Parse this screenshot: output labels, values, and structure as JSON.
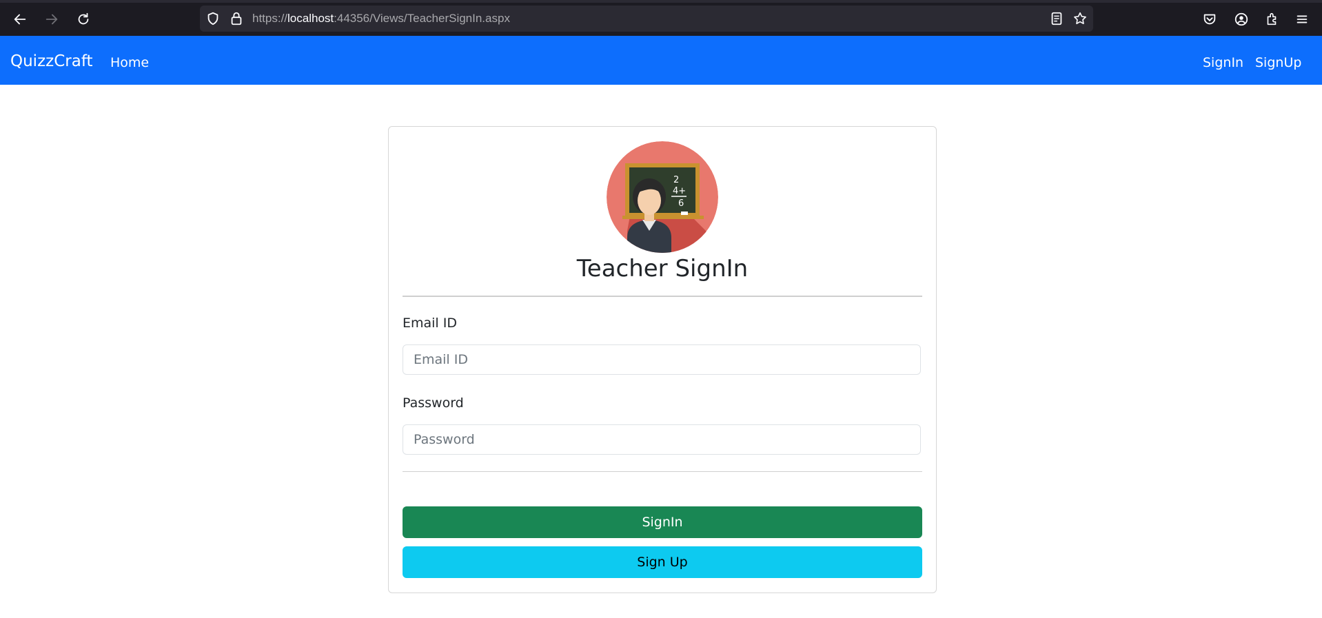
{
  "browser": {
    "url_prefix": "https://",
    "url_host": "localhost",
    "url_rest": ":44356/Views/TeacherSignIn.aspx",
    "icons": [
      "back-icon",
      "forward-icon",
      "reload-icon",
      "shield-icon",
      "lock-icon",
      "reader-view-icon",
      "bookmark-star-icon",
      "pocket-icon",
      "account-icon",
      "extensions-icon",
      "menu-icon"
    ]
  },
  "navbar": {
    "brand": "QuizzCraft",
    "home": "Home",
    "signin": "SignIn",
    "signup": "SignUp",
    "color": "#0d6efd"
  },
  "card": {
    "title": "Teacher SignIn",
    "email_label": "Email ID",
    "email_placeholder": "Email ID",
    "password_label": "Password",
    "password_placeholder": "Password",
    "signin_button": "SignIn",
    "signup_button": "Sign Up",
    "colors": {
      "signin": "#198754",
      "signup": "#0dcaf0",
      "avatar_bg": "#e8786d"
    }
  }
}
